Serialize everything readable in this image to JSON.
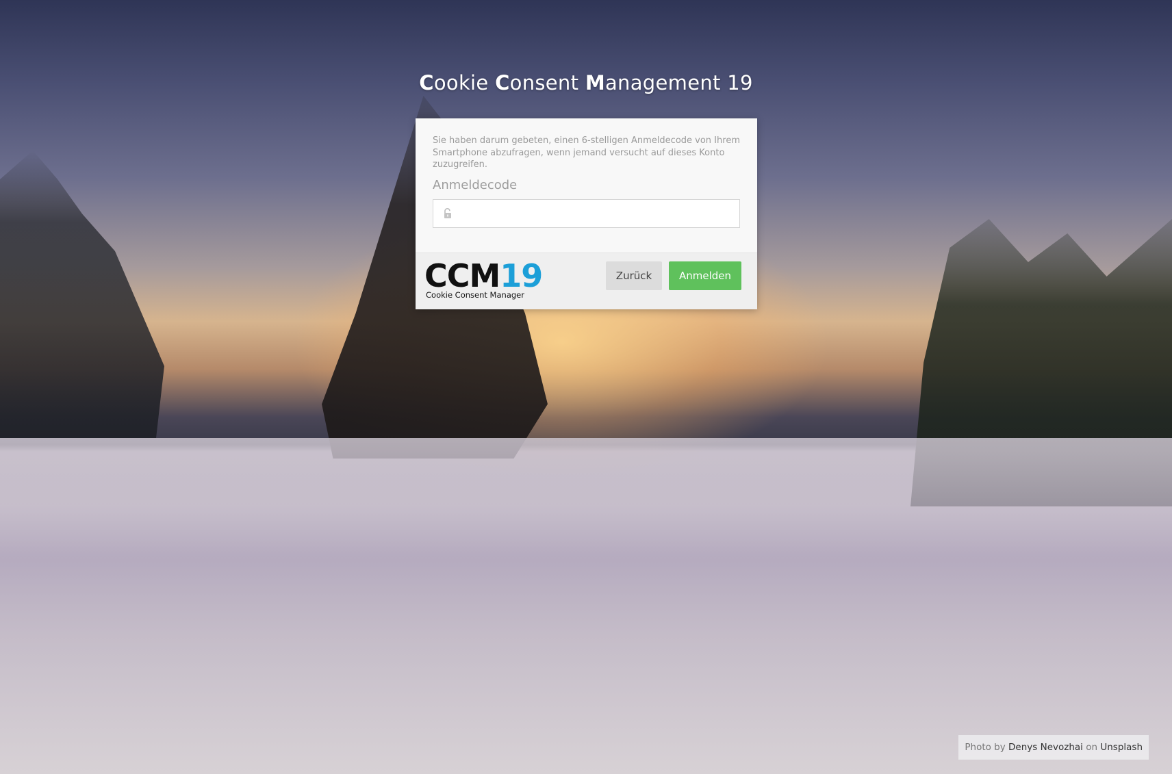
{
  "title": {
    "c1": "C",
    "rest1": "ookie ",
    "c2": "C",
    "rest2": "onsent ",
    "c3": "M",
    "rest3": "anagement 19"
  },
  "form": {
    "info": "Sie haben darum gebeten, einen 6-stelligen Anmeldecode von Ihrem Smartphone abzufragen, wenn jemand versucht auf dieses Konto zuzugreifen.",
    "code_label": "Anmeldecode",
    "code_value": "",
    "code_placeholder": ""
  },
  "logo": {
    "part1": "CCM",
    "part2": "19",
    "subtitle": "Cookie Consent Manager"
  },
  "buttons": {
    "back": "Zurück",
    "login": "Anmelden"
  },
  "credit": {
    "prefix": "Photo by",
    "author": "Denys Nevozhai",
    "on": "on",
    "site": "Unsplash"
  },
  "colors": {
    "login_button": "#5fc15c",
    "back_button": "#dcdcdc",
    "logo_accent": "#1c9fd8"
  }
}
